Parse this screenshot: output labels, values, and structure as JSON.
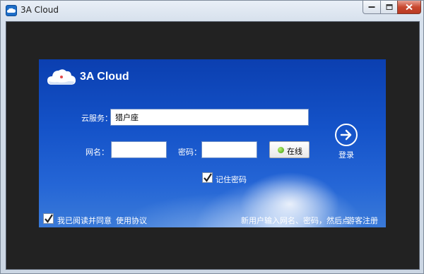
{
  "window": {
    "title": "3A Cloud"
  },
  "header": {
    "brand": "3A Cloud"
  },
  "form": {
    "cloud_service_label": "云服务：",
    "cloud_service_value": "猎户座",
    "net_name_label": "网名：",
    "net_name_value": "",
    "password_label": "密码：",
    "password_value": "",
    "status_button_label": "在线",
    "status_color": "#3c9d12",
    "remember_label": "记住密码",
    "remember_checked": true
  },
  "login": {
    "label": "登录"
  },
  "footer": {
    "agree_label": "我已阅读并同意",
    "agree_checked": true,
    "terms_link": "使用协议",
    "hint_text": "新用户输入网名、密码，然后点",
    "guest_register": "游客注册"
  },
  "colors": {
    "panel_blue": "#1452c8",
    "client_dark": "#222222"
  }
}
